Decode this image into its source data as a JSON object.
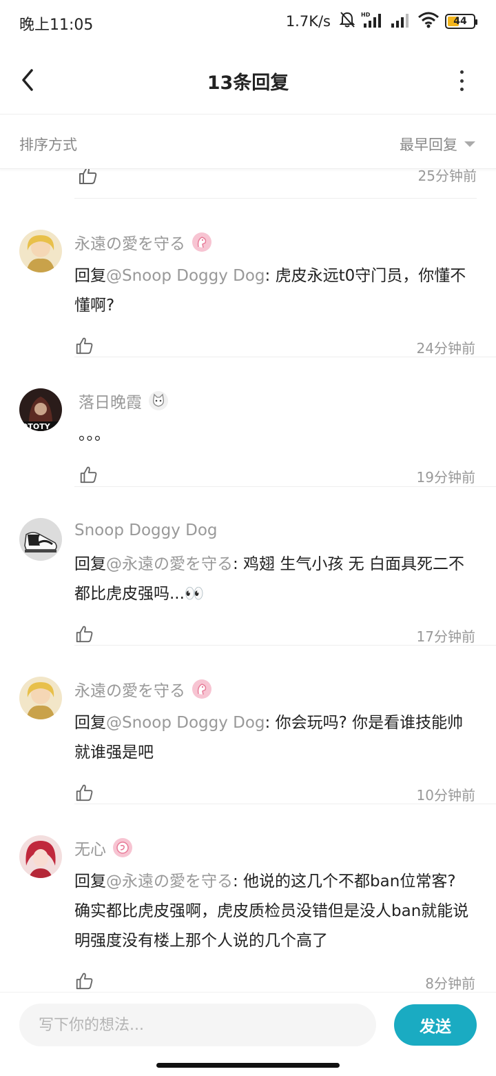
{
  "status_bar": {
    "time": "晚上11:05",
    "net_speed": "1.7K/s",
    "battery": "44",
    "battery_level": 0.44,
    "icons": [
      "mute-bell-icon",
      "hd-signal-icon",
      "signal-icon",
      "wifi-icon",
      "battery-icon"
    ]
  },
  "header": {
    "title": "13条回复",
    "back_icon": "chevron-left-icon",
    "more_icon": "more-vertical-icon"
  },
  "sort": {
    "label": "排序方式",
    "selected": "最早回复"
  },
  "partial_row": {
    "time": "25分钟前"
  },
  "comments": [
    {
      "name": "永遠の愛を守る",
      "badge": "pink-pony-badge",
      "prefix": "回复",
      "mention": "@Snoop Doggy Dog",
      "text": ": 虎皮永远t0守门员，你懂不懂啊?",
      "time": "24分钟前"
    },
    {
      "name": "落日晚霞",
      "badge": "cat-badge",
      "prefix": "",
      "mention": "",
      "text": "。。。",
      "time": "19分钟前"
    },
    {
      "name": "Snoop Doggy Dog",
      "badge": "",
      "prefix": "回复",
      "mention": "@永遠の愛を守る",
      "text": ": 鸡翅 生气小孩 无 白面具死二不都比虎皮强吗...👀",
      "time": "17分钟前"
    },
    {
      "name": "永遠の愛を守る",
      "badge": "pink-pony-badge",
      "prefix": "回复",
      "mention": "@Snoop Doggy Dog",
      "text": ": 你会玩吗? 你是看谁技能帅就谁强是吧",
      "time": "10分钟前"
    },
    {
      "name": "无心",
      "badge": "pink-swirl-badge",
      "prefix": "回复",
      "mention": "@永遠の愛を守る",
      "text": ": 他说的这几个不都ban位常客? 确实都比虎皮强啊，虎皮质检员没错但是没人ban就能说明强度没有楼上那个人说的几个高了",
      "time": "8分钟前"
    }
  ],
  "input": {
    "placeholder": "写下你的想法...",
    "send_label": "发送"
  },
  "colors": {
    "accent": "#1aabc2",
    "muted_text": "#999999",
    "badge_pink": "#f08fa6"
  }
}
